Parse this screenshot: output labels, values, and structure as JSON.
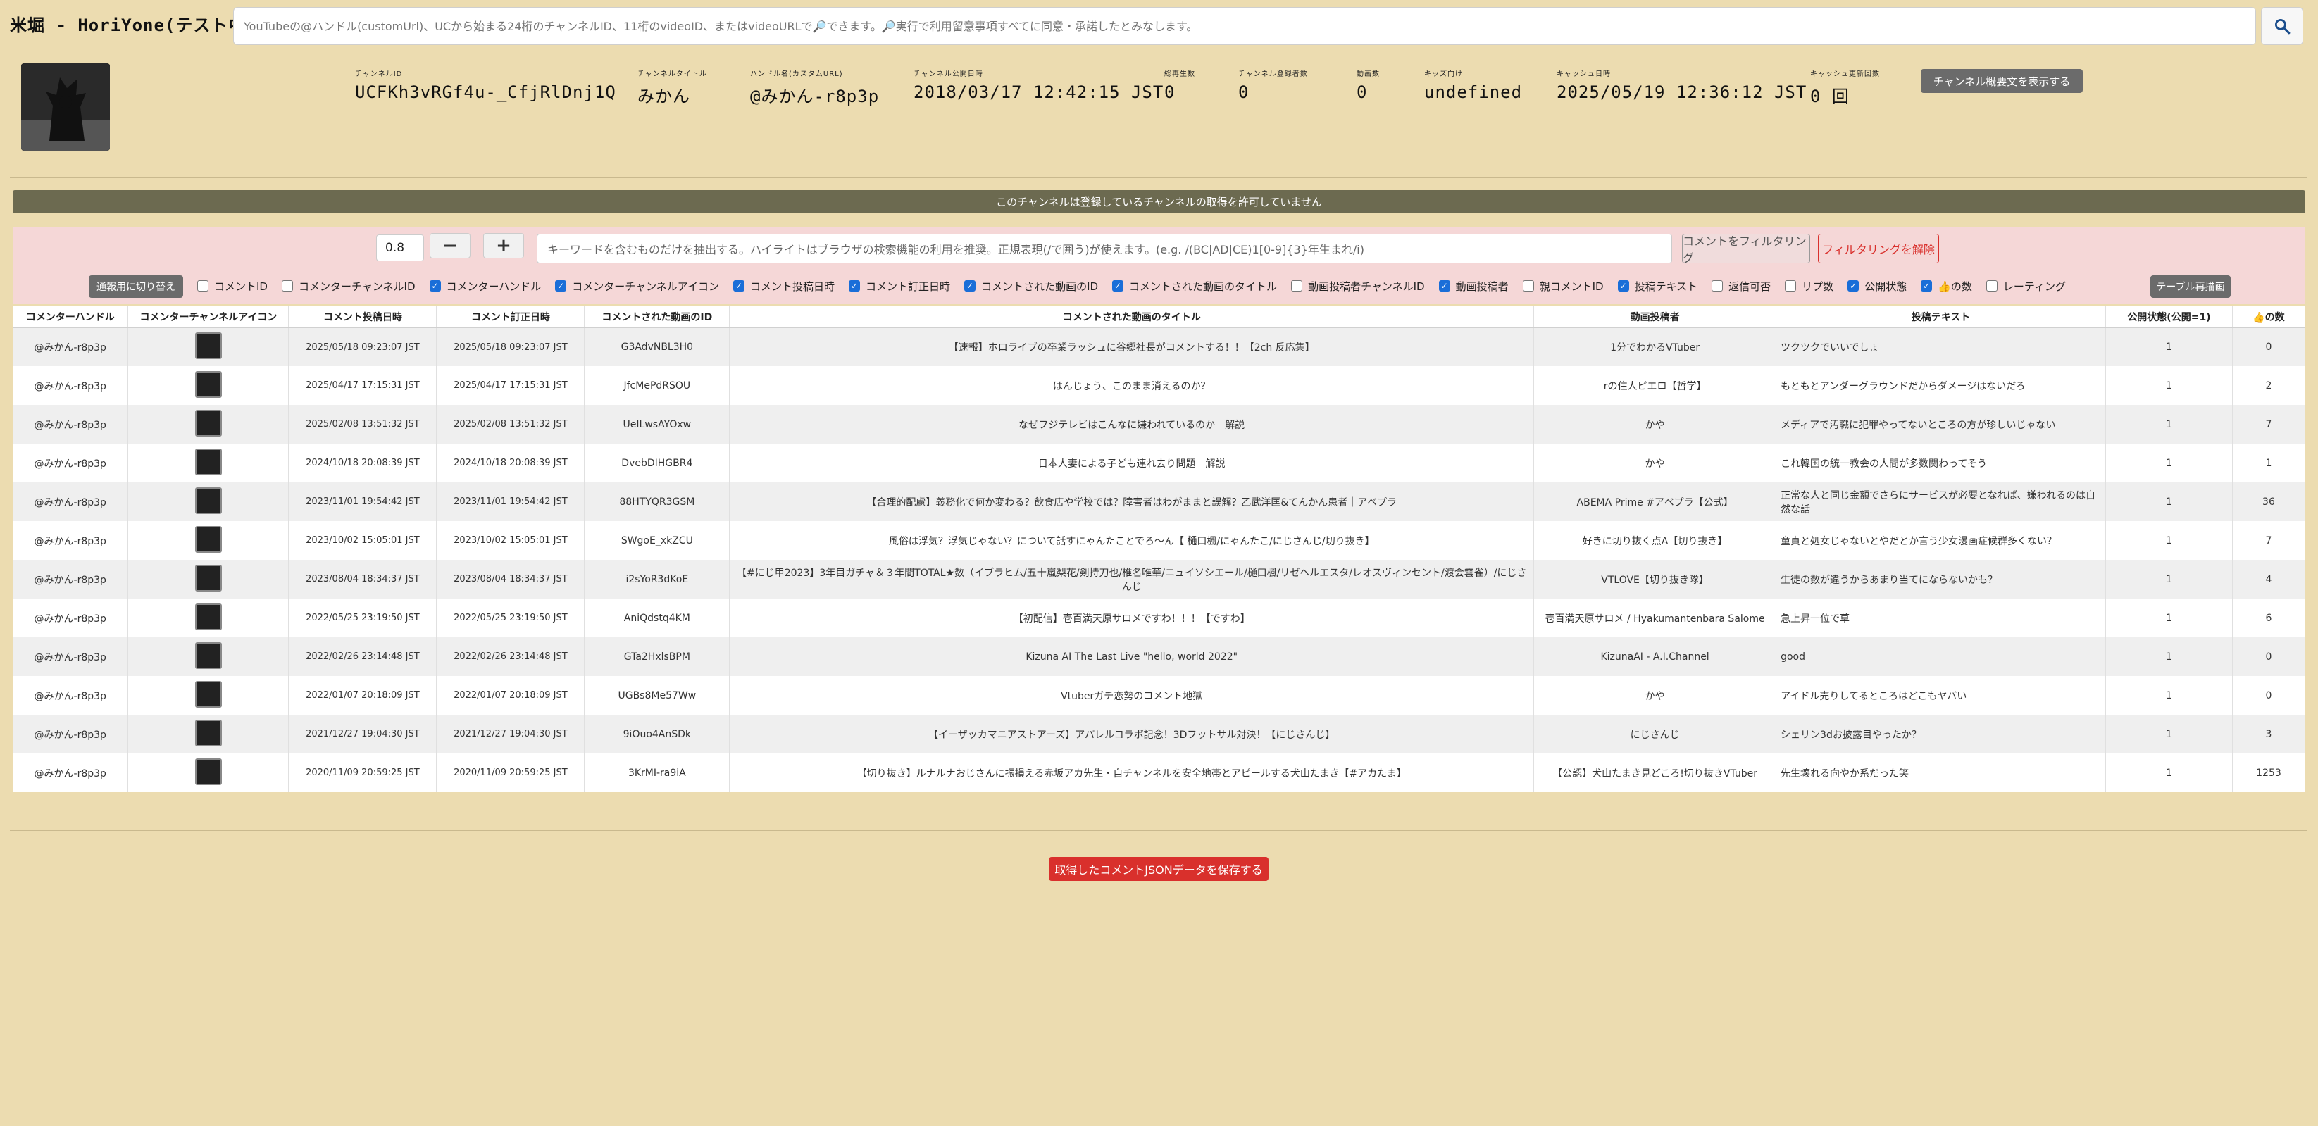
{
  "app": {
    "title": "米堀 - HoriYone(テスト中)"
  },
  "search": {
    "placeholder": "YouTubeの@ハンドル(customUrl)、UCから始まる24桁のチャンネルID、11桁のvideoID、またはvideoURLで🔎できます。🔎実行で利用留意事項すべてに同意・承諾したとみなします。",
    "button_icon": "search-icon"
  },
  "channel": {
    "fields": [
      {
        "label": "チャンネルID",
        "value": "UCFKh3vRGf4u-_CfjRlDnj1Q"
      },
      {
        "label": "チャンネルタイトル",
        "value": "みかん"
      },
      {
        "label": "ハンドル名(カスタムURL)",
        "value": "@みかん-r8p3p"
      },
      {
        "label": "チャンネル公開日時",
        "value": "2018/03/17 12:42:15 JST"
      },
      {
        "label": "総再生数",
        "value": "0"
      },
      {
        "label": "チャンネル登録者数",
        "value": "0"
      },
      {
        "label": "動画数",
        "value": "0"
      },
      {
        "label": "キッズ向け",
        "value": "undefined"
      },
      {
        "label": "キャッシュ日時",
        "value": "2025/05/19 12:36:12 JST"
      },
      {
        "label": "キャッシュ更新回数",
        "value": "0 回"
      }
    ],
    "show_summary_button": "チャンネル概要文を表示する"
  },
  "banner": "このチャンネルは登録しているチャンネルの取得を許可していません",
  "filter": {
    "threshold": "0.8",
    "minus": "−",
    "plus": "+",
    "placeholder": "キーワードを含むものだけを抽出する。ハイライトはブラウザの検索機能の利用を推奨。正規表現(/で囲う)が使えます。(e.g. /(BC|AD|CE)1[0-9]{3}年生まれ/i)",
    "filter_button": "コメントをフィルタリング",
    "clear_button": "フィルタリングを解除",
    "toggle_button": "通報用に切り替え",
    "redraw_button": "テーブル再描画",
    "checkboxes": [
      {
        "label": "コメントID",
        "checked": false
      },
      {
        "label": "コメンターチャンネルID",
        "checked": false
      },
      {
        "label": "コメンターハンドル",
        "checked": true
      },
      {
        "label": "コメンターチャンネルアイコン",
        "checked": true
      },
      {
        "label": "コメント投稿日時",
        "checked": true
      },
      {
        "label": "コメント訂正日時",
        "checked": true
      },
      {
        "label": "コメントされた動画のID",
        "checked": true
      },
      {
        "label": "コメントされた動画のタイトル",
        "checked": true
      },
      {
        "label": "動画投稿者チャンネルID",
        "checked": false
      },
      {
        "label": "動画投稿者",
        "checked": true
      },
      {
        "label": "親コメントID",
        "checked": false
      },
      {
        "label": "投稿テキスト",
        "checked": true
      },
      {
        "label": "返信可否",
        "checked": false
      },
      {
        "label": "リプ数",
        "checked": false
      },
      {
        "label": "公開状態",
        "checked": true
      },
      {
        "label": "👍の数",
        "checked": true
      },
      {
        "label": "レーティング",
        "checked": false
      }
    ]
  },
  "table": {
    "headers": [
      "コメンターハンドル",
      "コメンターチャンネルアイコン",
      "コメント投稿日時",
      "コメント訂正日時",
      "コメントされた動画のID",
      "コメントされた動画のタイトル",
      "動画投稿者",
      "投稿テキスト",
      "公開状態(公開=1)",
      "👍の数"
    ],
    "rows": [
      [
        "@みかん-r8p3p",
        "",
        "2025/05/18 09:23:07 JST",
        "2025/05/18 09:23:07 JST",
        "G3AdvNBL3H0",
        "【速報】ホロライブの卒業ラッシュに谷郷社長がコメントする！！【2ch 反応集】",
        "1分でわかるVTuber",
        "ツクツクでいいでしょ",
        "1",
        "0"
      ],
      [
        "@みかん-r8p3p",
        "",
        "2025/04/17 17:15:31 JST",
        "2025/04/17 17:15:31 JST",
        "JfcMePdRSOU",
        "はんじょう、このまま消えるのか？",
        "rの住人ピエロ【哲学】",
        "もともとアンダーグラウンドだからダメージはないだろ",
        "1",
        "2"
      ],
      [
        "@みかん-r8p3p",
        "",
        "2025/02/08 13:51:32 JST",
        "2025/02/08 13:51:32 JST",
        "UeILwsAYOxw",
        "なぜフジテレビはこんなに嫌われているのか　解説",
        "かや",
        "メディアで汚職に犯罪やってないところの方が珍しいじゃない",
        "1",
        "7"
      ],
      [
        "@みかん-r8p3p",
        "",
        "2024/10/18 20:08:39 JST",
        "2024/10/18 20:08:39 JST",
        "DvebDIHGBR4",
        "日本人妻による子ども連れ去り問題　解説",
        "かや",
        "これ韓国の統一教会の人間が多数関わってそう",
        "1",
        "1"
      ],
      [
        "@みかん-r8p3p",
        "",
        "2023/11/01 19:54:42 JST",
        "2023/11/01 19:54:42 JST",
        "88HTYQR3GSM",
        "【合理的配慮】義務化で何か変わる？飲食店や学校では？障害者はわがままと誤解？乙武洋匡&てんかん患者｜アベプラ",
        "ABEMA Prime #アベプラ【公式】",
        "正常な人と同じ金額でさらにサービスが必要となれば、嫌われるのは自然な話",
        "1",
        "36"
      ],
      [
        "@みかん-r8p3p",
        "",
        "2023/10/02 15:05:01 JST",
        "2023/10/02 15:05:01 JST",
        "SWgoE_xkZCU",
        "風俗は浮気？浮気じゃない？について話すにゃんたことでろ〜ん【 樋口楓/にゃんたこ/にじさんじ/切り抜き】",
        "好きに切り抜く点A【切り抜き】",
        "童貞と処女じゃないとやだとか言う少女漫画症候群多くない？",
        "1",
        "7"
      ],
      [
        "@みかん-r8p3p",
        "",
        "2023/08/04 18:34:37 JST",
        "2023/08/04 18:34:37 JST",
        "i2sYoR3dKoE",
        "【#にじ甲2023】3年目ガチャ＆３年間TOTAL★数（イブラヒム/五十嵐梨花/剣持刀也/椎名唯華/ニュイソシエール/樋口楓/リゼヘルエスタ/レオスヴィンセント/渡会雲雀）/にじさんじ",
        "VTLOVE【切り抜き隊】",
        "生徒の数が違うからあまり当てにならないかも？",
        "1",
        "4"
      ],
      [
        "@みかん-r8p3p",
        "",
        "2022/05/25 23:19:50 JST",
        "2022/05/25 23:19:50 JST",
        "AniQdstq4KM",
        "【初配信】壱百満天原サロメですわ！！！【ですわ】",
        "壱百満天原サロメ / Hyakumantenbara Salome",
        "急上昇一位で草",
        "1",
        "6"
      ],
      [
        "@みかん-r8p3p",
        "",
        "2022/02/26 23:14:48 JST",
        "2022/02/26 23:14:48 JST",
        "GTa2HxlsBPM",
        "Kizuna AI The Last Live \"hello, world 2022\"",
        "KizunaAI - A.I.Channel",
        "good",
        "1",
        "0"
      ],
      [
        "@みかん-r8p3p",
        "",
        "2022/01/07 20:18:09 JST",
        "2022/01/07 20:18:09 JST",
        "UGBs8Me57Ww",
        "Vtuberガチ恋勢のコメント地獄",
        "かや",
        "アイドル売りしてるところはどこもヤバい",
        "1",
        "0"
      ],
      [
        "@みかん-r8p3p",
        "",
        "2021/12/27 19:04:30 JST",
        "2021/12/27 19:04:30 JST",
        "9iOuo4AnSDk",
        "【イーザッカマニアストアーズ】アパレルコラボ記念！3Dフットサル対決！【にじさんじ】",
        "にじさんじ",
        "シェリン3dお披露目やったか？",
        "1",
        "3"
      ],
      [
        "@みかん-r8p3p",
        "",
        "2020/11/09 20:59:25 JST",
        "2020/11/09 20:59:25 JST",
        "3KrMI-ra9iA",
        "【切り抜き】ルナルナおじさんに振損える赤坂アカ先生・自チャンネルを安全地帯とアピールする犬山たまき【#アカたま】",
        "【公認】犬山たまき見どころ!切り抜きVTuber",
        "先生壊れる向やか系だった笑",
        "1",
        "1253"
      ]
    ]
  },
  "save_button": "取得したコメントJSONデータを保存する"
}
